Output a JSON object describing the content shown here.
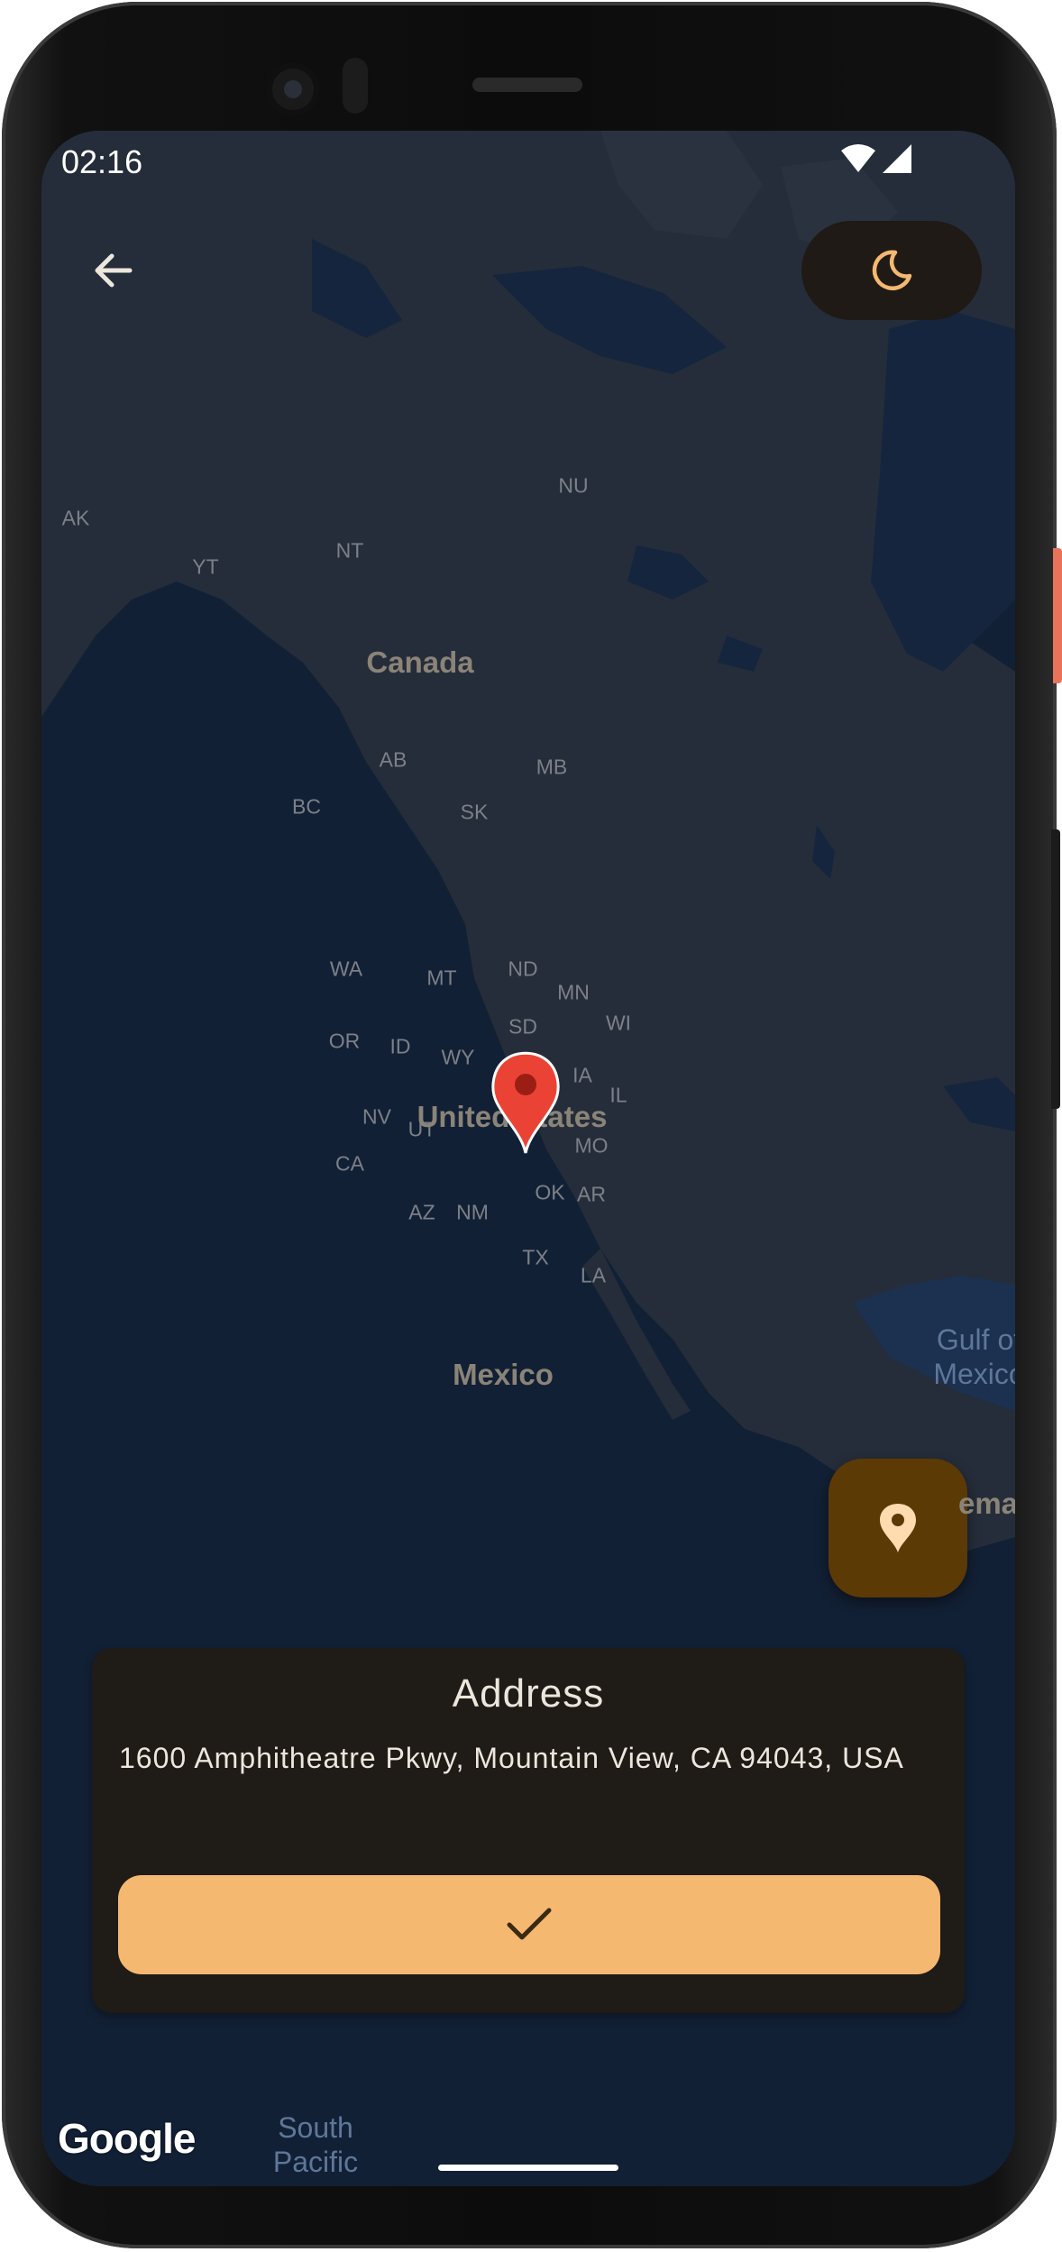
{
  "status_bar": {
    "time": "02:16"
  },
  "icons": {
    "back": "arrow-left-icon",
    "theme": "moon-icon",
    "locate": "location-pin-icon",
    "confirm": "check-icon",
    "wifi": "wifi-icon",
    "signal": "signal-icon",
    "map_marker": "map-marker-icon"
  },
  "map": {
    "country_labels": [
      "Canada",
      "United States",
      "Mexico"
    ],
    "region_labels": [
      "AK",
      "YT",
      "NT",
      "NU",
      "BC",
      "AB",
      "SK",
      "MB",
      "WA",
      "MT",
      "ND",
      "MN",
      "WI",
      "OR",
      "ID",
      "SD",
      "WY",
      "IA",
      "IL",
      "NV",
      "UT",
      "CA",
      "MO",
      "OK",
      "AR",
      "AZ",
      "NM",
      "TX",
      "LA"
    ],
    "water_labels": [
      "Gulf of\nMexico",
      "South\nPacific"
    ],
    "cut_label": "ema",
    "attribution": "Google"
  },
  "address_card": {
    "title": "Address",
    "address": "1600 Amphitheatre Pkwy, Mountain View, CA 94043, USA"
  },
  "colors": {
    "map_water": "#122035",
    "map_land": "#252d3a",
    "card_bg": "#1f1b17",
    "accent": "#f5b871",
    "fab_bg": "#5c3a05",
    "marker": "#ea4335"
  }
}
